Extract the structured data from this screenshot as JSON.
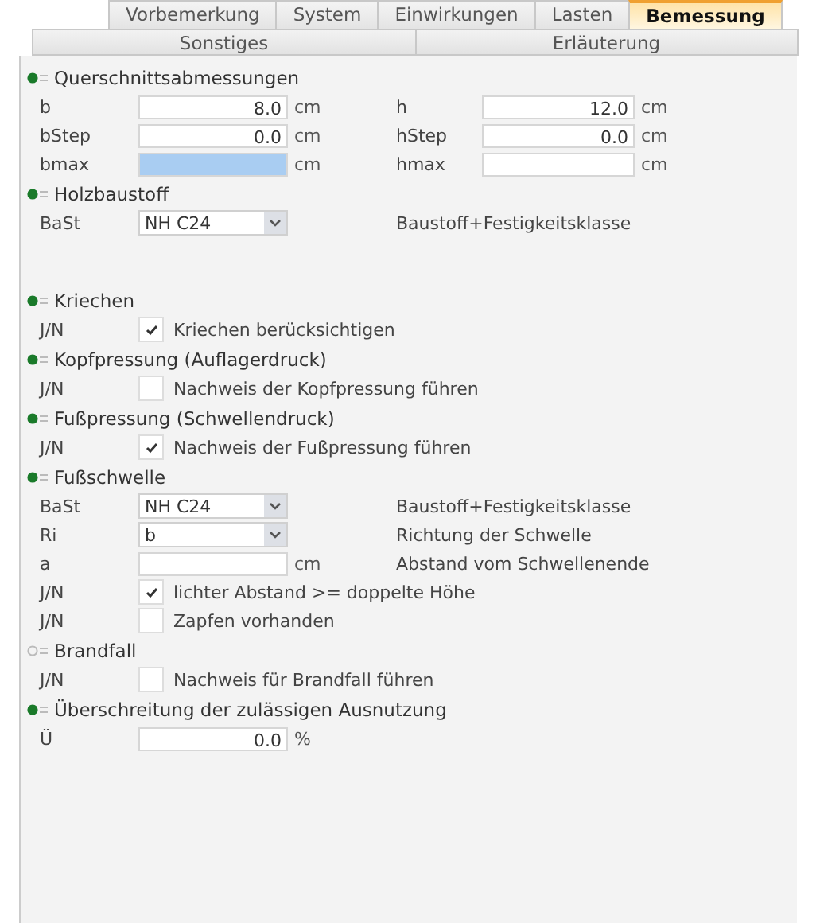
{
  "tabs": [
    {
      "label": "Vorbemerkung",
      "selected": false
    },
    {
      "label": "System",
      "selected": false
    },
    {
      "label": "Einwirkungen",
      "selected": false
    },
    {
      "label": "Lasten",
      "selected": false
    },
    {
      "label": "Bemessung",
      "selected": true
    }
  ],
  "subtabs": [
    {
      "label": "Sonstiges",
      "selected": false
    },
    {
      "label": "Erläuterung",
      "selected": false
    }
  ],
  "sections": [
    {
      "title": "Querschnittsabmessungen",
      "active": true,
      "rows": [
        {
          "kind": "pair",
          "items": [
            {
              "label": "b",
              "value": "8.0",
              "unit": "cm",
              "focused": false
            },
            {
              "label": "h",
              "value": "12.0",
              "unit": "cm",
              "focused": false
            }
          ]
        },
        {
          "kind": "pair",
          "items": [
            {
              "label": "bStep",
              "value": "0.0",
              "unit": "cm",
              "focused": false
            },
            {
              "label": "hStep",
              "value": "0.0",
              "unit": "cm",
              "focused": false
            }
          ]
        },
        {
          "kind": "pair",
          "items": [
            {
              "label": "bmax",
              "unit": "cm",
              "focused": true
            },
            {
              "label": "hmax",
              "unit": "cm",
              "focused": false
            }
          ]
        }
      ]
    },
    {
      "title": "Holzbaustoff",
      "active": true,
      "rows": [
        {
          "kind": "select",
          "label": "BaSt",
          "value": "NH C24",
          "description": "Baustoff+Festigkeitsklasse"
        },
        {
          "kind": "blank"
        }
      ]
    },
    {
      "title": "Kriechen",
      "active": true,
      "rows": [
        {
          "kind": "check",
          "label": "J/N",
          "checked": true,
          "text": "Kriechen berücksichtigen"
        }
      ]
    },
    {
      "title": "Kopfpressung (Auflagerdruck)",
      "active": true,
      "rows": [
        {
          "kind": "check",
          "label": "J/N",
          "checked": false,
          "text": "Nachweis der Kopfpressung führen"
        }
      ]
    },
    {
      "title": "Fußpressung (Schwellendruck)",
      "active": true,
      "rows": [
        {
          "kind": "check",
          "label": "J/N",
          "checked": true,
          "text": "Nachweis der Fußpressung führen"
        }
      ]
    },
    {
      "title": "Fußschwelle",
      "active": true,
      "rows": [
        {
          "kind": "select",
          "label": "BaSt",
          "value": "NH C24",
          "description": "Baustoff+Festigkeitsklasse"
        },
        {
          "kind": "select",
          "label": "Ri",
          "value": "b",
          "description": "Richtung der Schwelle"
        },
        {
          "kind": "input",
          "label": "a",
          "unit": "cm",
          "description": "Abstand vom Schwellenende"
        },
        {
          "kind": "check",
          "label": "J/N",
          "checked": true,
          "text": "lichter Abstand >= doppelte Höhe"
        },
        {
          "kind": "check",
          "label": "J/N",
          "checked": false,
          "text": "Zapfen vorhanden"
        }
      ]
    },
    {
      "title": "Brandfall",
      "active": false,
      "rows": [
        {
          "kind": "check",
          "label": "J/N",
          "checked": false,
          "text": "Nachweis für Brandfall führen"
        }
      ]
    },
    {
      "title": "Überschreitung der zulässigen Ausnutzung",
      "active": true,
      "rows": [
        {
          "kind": "input",
          "label": "Ü",
          "value": "0.0",
          "unit": "%"
        }
      ]
    }
  ]
}
